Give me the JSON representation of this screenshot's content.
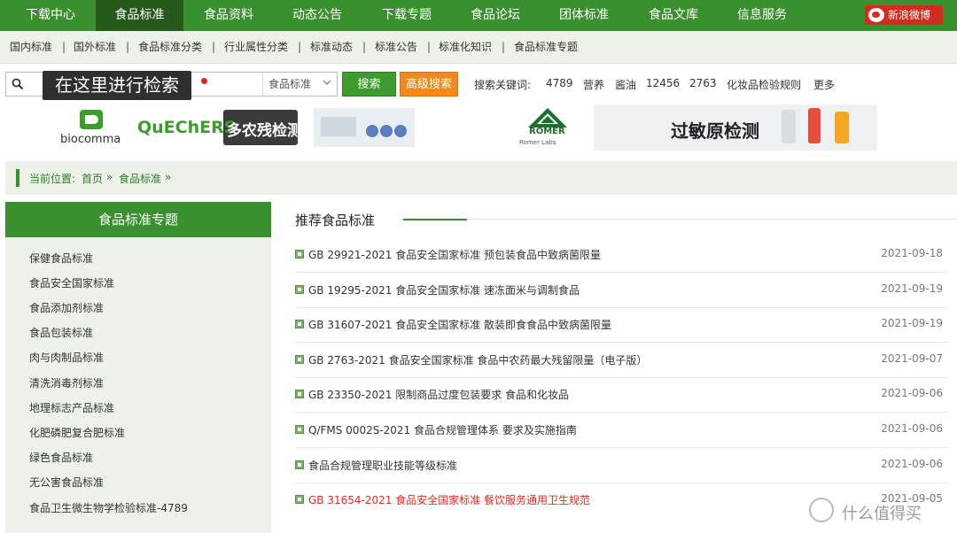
{
  "topnav": [
    {
      "label": "下载中心",
      "active": false
    },
    {
      "label": "食品标准",
      "active": true
    },
    {
      "label": "食品资料",
      "active": false
    },
    {
      "label": "动态公告",
      "active": false
    },
    {
      "label": "下载专题",
      "active": false
    },
    {
      "label": "食品论坛",
      "active": false
    },
    {
      "label": "团体标准",
      "active": false
    },
    {
      "label": "食品文库",
      "active": false
    },
    {
      "label": "信息服务",
      "active": false
    }
  ],
  "weibo_label": "新浪微博",
  "subnav": [
    "国内标准",
    "国外标准",
    "食品标准分类",
    "行业属性分类",
    "标准动态",
    "标准公告",
    "标准化知识",
    "食品标准专题"
  ],
  "search": {
    "tooltip": "在这里进行检索",
    "select_value": "食品标准",
    "search_button": "搜索",
    "advanced_button": "高级搜索",
    "keywords_label": "搜索关键词:",
    "keywords": [
      "4789",
      "营养",
      "酱油",
      "12456",
      "2763",
      "化妆品检验规则",
      "更多"
    ]
  },
  "banners": {
    "left": {
      "brand": "biocomma",
      "product": "QuEChERS",
      "tag": "多农残检测"
    },
    "right": {
      "brand": "ROMER",
      "brand_sub": "Romer Labs",
      "tag": "过敏原检测"
    }
  },
  "breadcrumb": {
    "prefix": "当前位置:",
    "home": "首页",
    "sep1": "»",
    "current": "食品标准",
    "sep2": "»"
  },
  "sidebar": {
    "title": "食品标准专题",
    "items": [
      "保健食品标准",
      "食品安全国家标准",
      "食品添加剂标准",
      "食品包装标准",
      "肉与肉制品标准",
      "清洗消毒剂标准",
      "地理标志产品标准",
      "化肥磷肥复合肥标准",
      "绿色食品标准",
      "无公害食品标准",
      "食品卫生微生物学检验标准-4789"
    ]
  },
  "main": {
    "title": "推荐食品标准",
    "rows": [
      {
        "title": "GB 29921-2021 食品安全国家标准 预包装食品中致病菌限量",
        "date": "2021-09-18",
        "highlight": false
      },
      {
        "title": "GB 19295-2021 食品安全国家标准 速冻面米与调制食品",
        "date": "2021-09-19",
        "highlight": false
      },
      {
        "title": "GB 31607-2021 食品安全国家标准 散装即食食品中致病菌限量",
        "date": "2021-09-19",
        "highlight": false
      },
      {
        "title": "GB 2763-2021 食品安全国家标准 食品中农药最大残留限量（电子版）",
        "date": "2021-09-07",
        "highlight": false
      },
      {
        "title": "GB 23350-2021 限制商品过度包装要求 食品和化妆品",
        "date": "2021-09-06",
        "highlight": false
      },
      {
        "title": "Q/FMS 0002S-2021 食品合规管理体系 要求及实施指南",
        "date": "2021-09-06",
        "highlight": false
      },
      {
        "title": "食品合规管理职业技能等级标准",
        "date": "2021-09-06",
        "highlight": false
      },
      {
        "title": "GB 31654-2021 食品安全国家标准 餐饮服务通用卫生规范",
        "date": "2021-09-05",
        "highlight": true
      }
    ]
  },
  "watermark": "什么值得买",
  "colors": {
    "primary_green": "#3a8f2e",
    "active_green": "#265a1c",
    "orange": "#f08a1c",
    "red": "#e12b1f"
  }
}
